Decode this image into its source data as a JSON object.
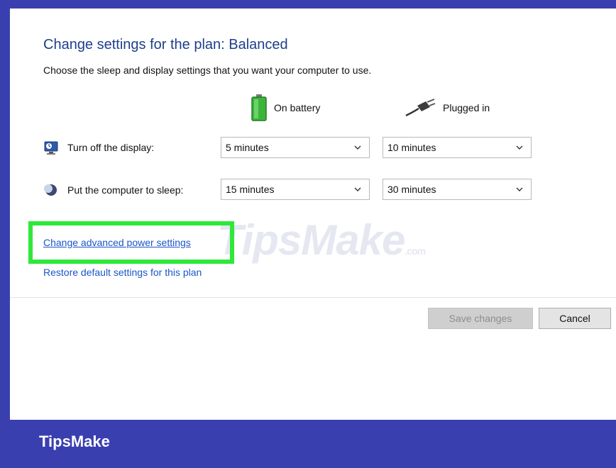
{
  "header": {
    "title": "Change settings for the plan: Balanced",
    "subtitle": "Choose the sleep and display settings that you want your computer to use."
  },
  "columns": {
    "battery": {
      "label": "On battery",
      "icon": "battery-icon"
    },
    "plugged": {
      "label": "Plugged in",
      "icon": "plug-icon"
    }
  },
  "rows": {
    "display": {
      "label": "Turn off the display:",
      "icon": "monitor-icon",
      "battery_value": "5 minutes",
      "plugged_value": "10 minutes"
    },
    "sleep": {
      "label": "Put the computer to sleep:",
      "icon": "moon-icon",
      "battery_value": "15 minutes",
      "plugged_value": "30 minutes"
    }
  },
  "links": {
    "advanced": "Change advanced power settings",
    "restore": "Restore default settings for this plan"
  },
  "watermark": {
    "text": "TipsMake",
    "suffix": ".com"
  },
  "buttons": {
    "save": "Save changes",
    "cancel": "Cancel"
  },
  "footer": {
    "brand": "TipsMake"
  },
  "colors": {
    "frame_background": "#3a3fb0",
    "title": "#1e3f8a",
    "link": "#1a56c8",
    "highlight": "#2ee83a"
  }
}
